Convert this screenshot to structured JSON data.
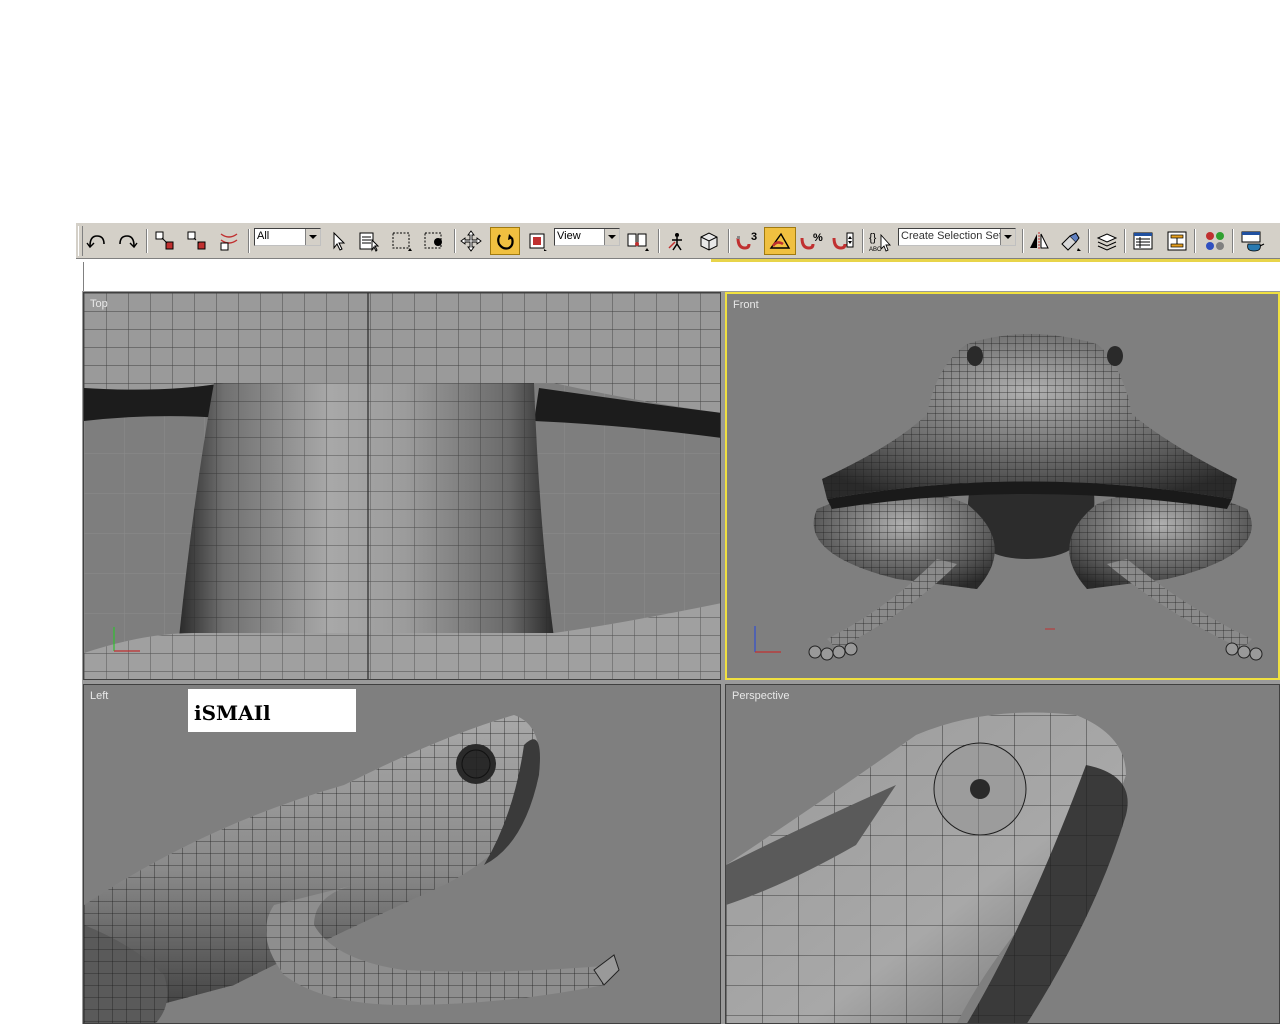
{
  "toolbar": {
    "selection_filter": "All",
    "reference_coord_system": "View",
    "named_selection_set_placeholder": "Create Selection Set",
    "snap_label": "3",
    "percent_snap_label": "%",
    "edit_named_sel_label": "ABC",
    "colors": {
      "active_button": "#f0c040",
      "background": "#d4d0c8",
      "accent": "#e8d44a"
    }
  },
  "viewports": {
    "top": {
      "label": "Top"
    },
    "front": {
      "label": "Front"
    },
    "left": {
      "label": "Left"
    },
    "perspective": {
      "label": "Perspective"
    },
    "active_border_color": "#f0e040"
  },
  "overlay": {
    "text": "iSMAIl"
  }
}
